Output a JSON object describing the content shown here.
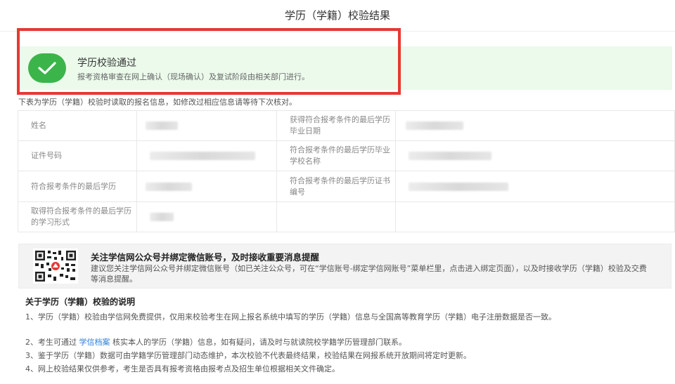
{
  "header": {
    "title": "学历（学籍）校验结果"
  },
  "banner": {
    "title": "学历校验通过",
    "subtitle": "报考资格审查在网上确认（现场确认）及复试阶段由相关部门进行。",
    "check_color": "#3bb54a",
    "highlight_color": "#e53935"
  },
  "table": {
    "intro": "下表为学历（学籍）校验时读取的报名信息，如修改过相应信息请等待下次核对。",
    "rows": [
      {
        "label_a": "姓名",
        "label_b": "获得符合报考条件的最后学历毕业日期"
      },
      {
        "label_a": "证件号码",
        "label_b": "符合报考条件的最后学历毕业学校名称"
      },
      {
        "label_a": "符合报考条件的最后学历",
        "label_b": "符合报考条件的最后学历证书编号"
      },
      {
        "label_a": "取得符合报考条件的最后学历的学习形式",
        "label_b": ""
      }
    ]
  },
  "wechat": {
    "title": "关注学信网公众号并绑定微信账号，及时接收重要消息提醒",
    "desc": "建议您关注学信网公众号并绑定微信账号（如已关注公众号，可在“学信账号-绑定学信网账号”菜单栏里，点击进入绑定页面），以及时接收学历（学籍）校验及交费等消息提醒。",
    "qr_icon": "qr-code-icon"
  },
  "notes": {
    "title": "关于学历（学籍）校验的说明",
    "n1": "1、学历（学籍）校验由学信网免费提供，仅用来校验考生在网上报名系统中填写的学历（学籍）信息与全国高等教育学历（学籍）电子注册数据是否一致。",
    "n2_before": "2、考生可通过",
    "n2_link": "学信档案",
    "n2_after": "核实本人的学历（学籍）信息，如有疑问，请及时与就读院校学籍学历管理部门联系。",
    "n3": "3、鉴于学历（学籍）数据可由学籍学历管理部门动态维护，本次校验不代表最终结果，校验结果在网报系统开放期间将定时更新。",
    "n4": "4、网上校验结果仅供参考，考生是否具有报考资格由报考点及招生单位根据相关文件确定。"
  }
}
